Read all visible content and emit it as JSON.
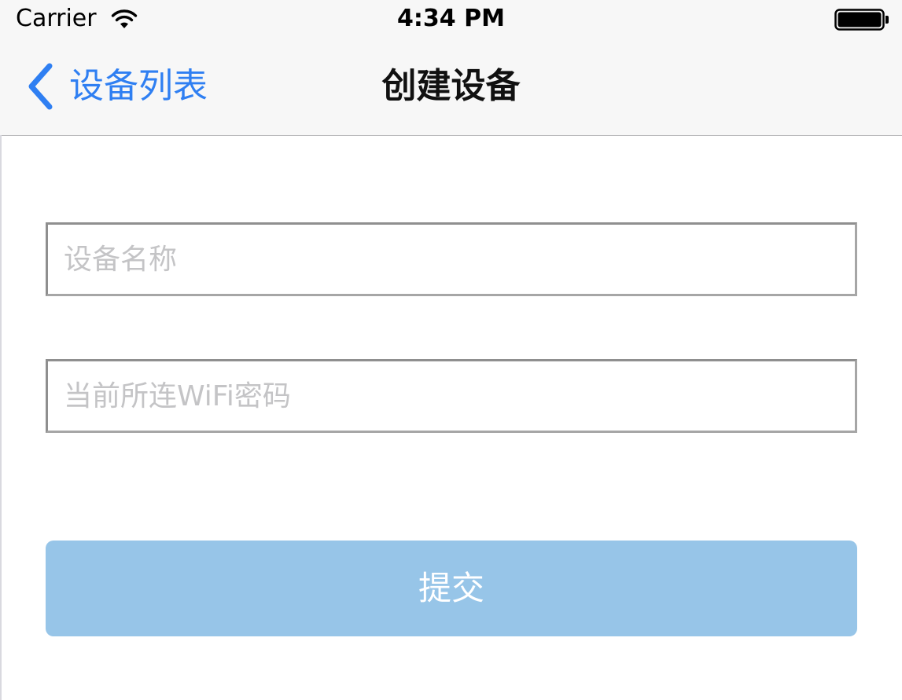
{
  "status_bar": {
    "carrier": "Carrier",
    "time": "4:34 PM",
    "icons": [
      "wifi-icon",
      "battery-icon"
    ]
  },
  "nav_bar": {
    "back_label": "设备列表",
    "title": "创建设备",
    "back_icon": "chevron-left-icon",
    "accent_color": "#2f7ff2"
  },
  "form": {
    "device_name_placeholder": "设备名称",
    "device_name_value": "",
    "wifi_password_placeholder": "当前所连WiFi密码",
    "wifi_password_value": "",
    "submit_label": "提交",
    "submit_color": "#97c5e8"
  }
}
